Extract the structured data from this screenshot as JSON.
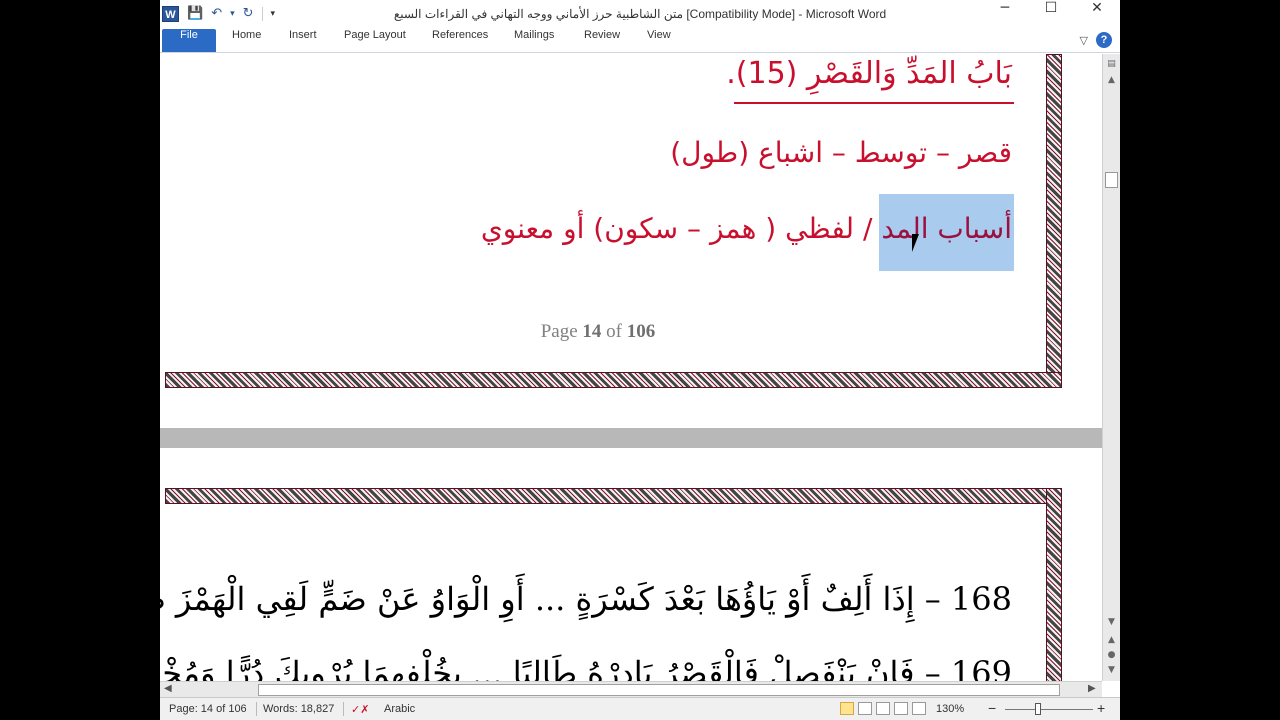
{
  "window": {
    "title": "متن الشاطبية حرز الأماني ووجه التهاني في القراءات السبع [Compatibility Mode]  -  Microsoft Word",
    "minimize": "─",
    "maximize": "☐",
    "close": "✕"
  },
  "quick_access": {
    "app_icon": "W",
    "save": "💾",
    "undo": "↶",
    "undo_drop": "▾",
    "redo": "↻",
    "customize": "▾"
  },
  "ribbon": {
    "tabs": [
      "File",
      "Home",
      "Insert",
      "Page Layout",
      "References",
      "Mailings",
      "Review",
      "View"
    ],
    "collapse": "▽",
    "help": "?"
  },
  "document": {
    "heading1": "بَابُ المَدِّ وَالقَصْرِ (15).",
    "heading2": "قصر – توسط – اشباع (طول)",
    "heading3_part1": "أسباب المد",
    "heading3_part2": " / لفظي ( همز – سكون) أو معنوي",
    "page_footer_prefix": "Page ",
    "page_footer_num": "14",
    "page_footer_of": " of ",
    "page_footer_total": "106",
    "verse1": "168 – إِذَا أَلِفٌ أَوْ يَاؤُهَا بَعْدَ كَسْرَةٍ ... أَوِ الْوَاوُ عَنْ ضَمٍّ لَقِي الْهَمْزَ طُوِّلَا",
    "verse2": "169 – فَإِنْ يَنْفَصِلْ فَالْقَصْرُ بَادِرْهُ طَالِبًا ... بِخُلْفِهِمَا يُرْوِيكَ دُرًّا وَمُخْضِلَا"
  },
  "statusbar": {
    "page": "Page: 14 of 106",
    "words": "Words: 18,827",
    "language": "Arabic",
    "zoom": "130%",
    "zoom_minus": "−",
    "zoom_plus": "+"
  },
  "colors": {
    "heading": "#c8102e",
    "selection": "#a9cbee",
    "ribbon_file": "#2b6bc5"
  }
}
